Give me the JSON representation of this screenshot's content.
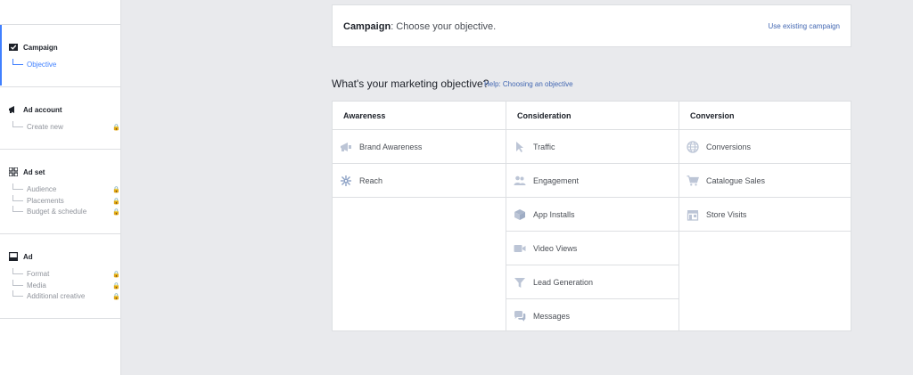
{
  "sidebar": {
    "campaign": {
      "label": "Campaign",
      "items": [
        {
          "label": "Objective"
        }
      ]
    },
    "ad_account": {
      "label": "Ad account",
      "items": [
        {
          "label": "Create new"
        }
      ]
    },
    "ad_set": {
      "label": "Ad set",
      "items": [
        {
          "label": "Audience"
        },
        {
          "label": "Placements"
        },
        {
          "label": "Budget & schedule"
        }
      ]
    },
    "ad": {
      "label": "Ad",
      "items": [
        {
          "label": "Format"
        },
        {
          "label": "Media"
        },
        {
          "label": "Additional creative"
        }
      ]
    },
    "lock_icon": "lock-icon"
  },
  "campaign_card": {
    "title_bold": "Campaign",
    "title_rest": ": Choose your objective.",
    "use_existing": "Use existing campaign"
  },
  "objectives": {
    "heading": "What's your marketing objective?",
    "help_link": "Help: Choosing an objective",
    "columns": [
      {
        "title": "Awareness",
        "items": [
          {
            "label": "Brand Awareness",
            "icon": "megaphone-icon"
          },
          {
            "label": "Reach",
            "icon": "snowflake-icon"
          }
        ]
      },
      {
        "title": "Consideration",
        "items": [
          {
            "label": "Traffic",
            "icon": "cursor-icon"
          },
          {
            "label": "Engagement",
            "icon": "people-icon"
          },
          {
            "label": "App Installs",
            "icon": "box-icon"
          },
          {
            "label": "Video Views",
            "icon": "video-icon"
          },
          {
            "label": "Lead Generation",
            "icon": "funnel-icon"
          },
          {
            "label": "Messages",
            "icon": "chat-icon"
          }
        ]
      },
      {
        "title": "Conversion",
        "items": [
          {
            "label": "Conversions",
            "icon": "globe-icon"
          },
          {
            "label": "Catalogue Sales",
            "icon": "cart-icon"
          },
          {
            "label": "Store Visits",
            "icon": "store-icon"
          }
        ]
      }
    ]
  },
  "colors": {
    "accent": "#4080ff",
    "link": "#4267b2",
    "icon": "#bcc5d6",
    "background": "#e9eaed"
  }
}
